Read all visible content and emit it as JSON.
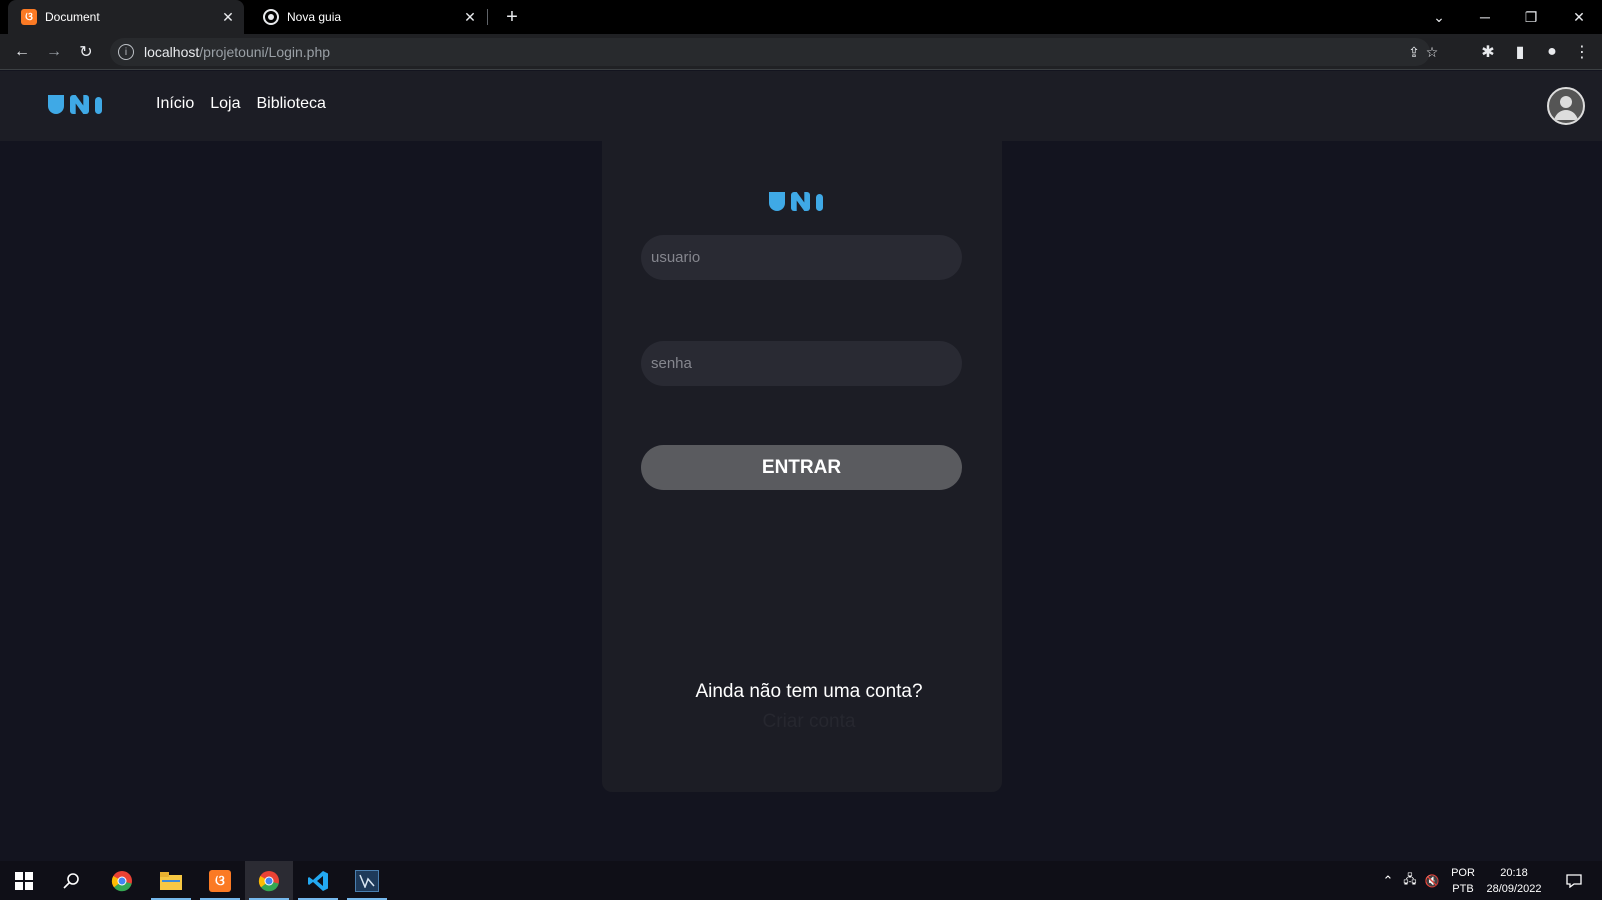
{
  "browser": {
    "tabs": [
      {
        "title": "Document",
        "favicon": "xampp-icon",
        "active": true
      },
      {
        "title": "Nova guia",
        "favicon": "chrome-icon",
        "active": false
      }
    ],
    "url_host": "localhost",
    "url_path": "/projetouni/Login.php"
  },
  "site": {
    "nav": {
      "links": [
        "Início",
        "Loja",
        "Biblioteca"
      ]
    }
  },
  "login": {
    "username_placeholder": "usuario",
    "password_placeholder": "senha",
    "submit_label": "ENTRAR",
    "no_account_text": "Ainda não tem uma conta?",
    "create_account_link": "Criar conta"
  },
  "taskbar": {
    "lang_top": "POR",
    "lang_bottom": "PTB",
    "time": "20:18",
    "date": "28/09/2022"
  },
  "colors": {
    "accent": "#3fa9e6",
    "page_bg": "#13141f",
    "card_bg": "#1c1d25",
    "input_bg": "#292a33",
    "button_bg": "#5a5b5f"
  }
}
